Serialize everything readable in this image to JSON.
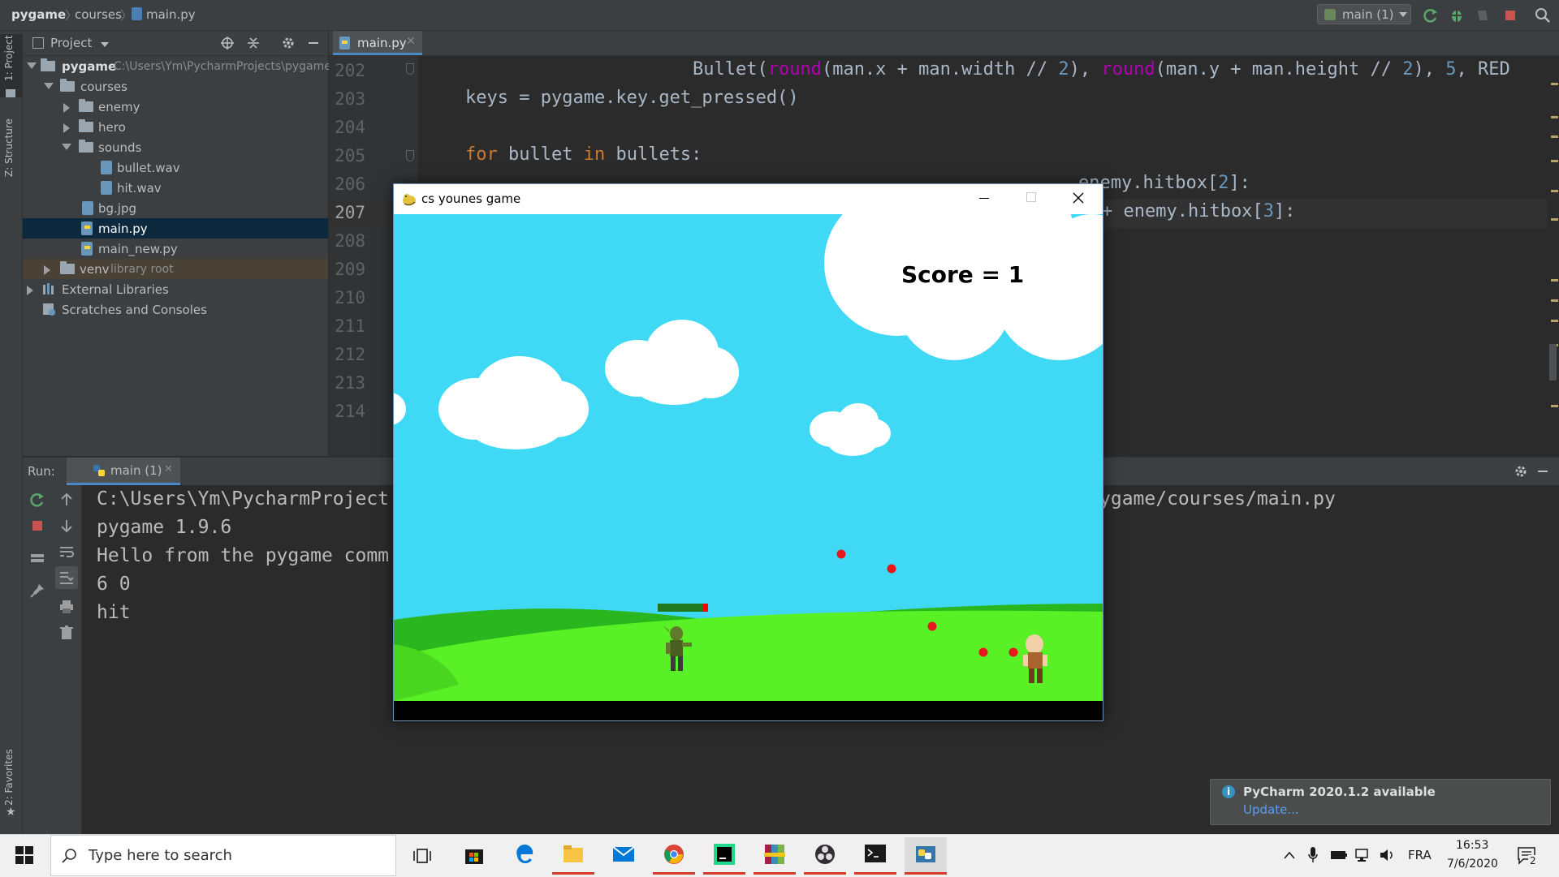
{
  "breadcrumb": {
    "root": "pygame",
    "folder": "courses",
    "file": "main.py"
  },
  "run_config": {
    "label": "main (1)"
  },
  "left_stripe": {
    "project_tab": "1: Project",
    "structure_tab": "Z: Structure",
    "favorites_tab": "2: Favorites"
  },
  "project_panel": {
    "title": "Project",
    "tree": [
      {
        "label": "pygame",
        "path": "C:\\Users\\Ym\\PycharmProjects\\pygame"
      },
      {
        "label": "courses"
      },
      {
        "label": "enemy"
      },
      {
        "label": "hero"
      },
      {
        "label": "sounds"
      },
      {
        "label": "bullet.wav"
      },
      {
        "label": "hit.wav"
      },
      {
        "label": "bg.jpg"
      },
      {
        "label": "main.py"
      },
      {
        "label": "main_new.py"
      },
      {
        "label": "venv",
        "note": "library root"
      },
      {
        "label": "External Libraries"
      },
      {
        "label": "Scratches and Consoles"
      }
    ]
  },
  "editor": {
    "tab_label": "main.py",
    "line_numbers": [
      "202",
      "203",
      "204",
      "205",
      "206",
      "207",
      "208",
      "209",
      "210",
      "211",
      "212",
      "213",
      "214"
    ],
    "lines": {
      "l202_a": "Bullet(",
      "l202_b": "round",
      "l202_c": "(man.x + man.width // ",
      "l202_d": "2",
      "l202_e": "), ",
      "l202_f": "round",
      "l202_g": "(man.y + man.height // ",
      "l202_h": "2",
      "l202_i": "), ",
      "l202_j": "5",
      "l202_k": ", RED",
      "l203": "keys = pygame.key.get_pressed()",
      "l205_kw1": "for",
      "l205_a": " bullet ",
      "l205_kw2": "in",
      "l205_b": " bullets:",
      "l206_a": "enemy.hitbox[",
      "l206_b": "2",
      "l206_c": "]:",
      "l207_a": "+ enemy.hitbox[",
      "l207_b": "3",
      "l207_c": "]:"
    }
  },
  "run_panel": {
    "label": "Run:",
    "tab_label": "main (1)",
    "console": [
      "C:\\Users\\Ym\\PycharmProject",
      "ygame/courses/main.py",
      "pygame 1.9.6",
      "Hello from the pygame comm",
      "6 0",
      "hit"
    ]
  },
  "notification": {
    "title": "PyCharm 2020.1.2 available",
    "link": "Update..."
  },
  "game_window": {
    "title": "cs younes game",
    "score_text": "Score = 1"
  },
  "taskbar": {
    "search_placeholder": "Type here to search",
    "language": "FRA",
    "time": "16:53",
    "date": "7/6/2020",
    "notification_count": "2"
  }
}
